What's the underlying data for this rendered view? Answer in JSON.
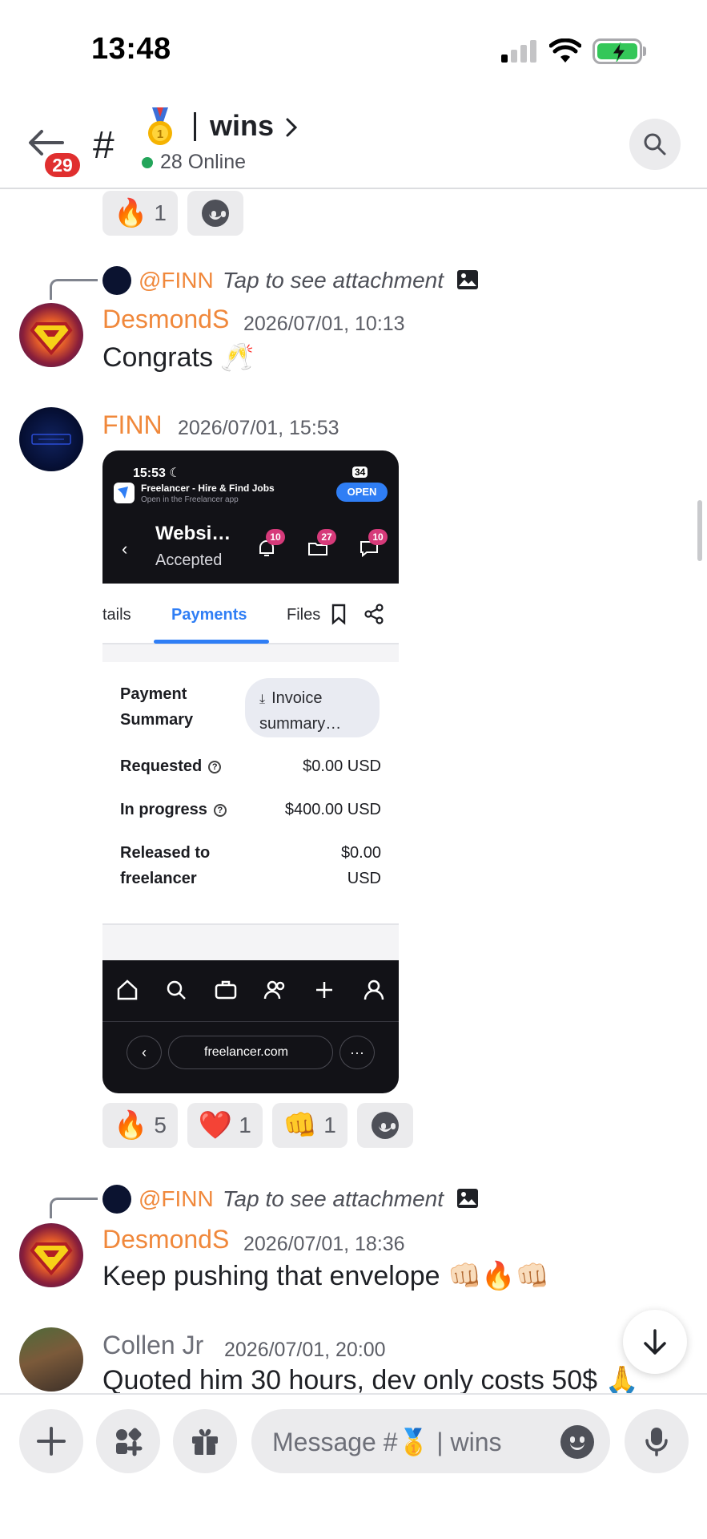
{
  "status_bar": {
    "time": "13:48"
  },
  "header": {
    "back_badge": "29",
    "hash": "#",
    "channel_emoji": "🥇",
    "channel_name": "wins",
    "online_text": "28 Online"
  },
  "messages": [
    {
      "type": "reactions",
      "reactions": [
        {
          "emoji": "🔥",
          "count": "1"
        }
      ]
    },
    {
      "type": "message",
      "reply": {
        "author": "@FINN",
        "text": "Tap to see attachment"
      },
      "author": "DesmondS",
      "timestamp": "2026/07/01, 10:13",
      "text": "Congrats 🥂"
    },
    {
      "type": "message",
      "author": "FINN",
      "timestamp": "2026/07/01, 15:53",
      "attachment": {
        "time": "15:53 ☾",
        "battery": "34",
        "app_name": "Freelancer - Hire & Find Jobs",
        "app_sub": "Open in the Freelancer app",
        "open_label": "OPEN",
        "title": "Websi…",
        "subtitle": "Accepted",
        "badges": [
          "10",
          "27",
          "10"
        ],
        "tabs": [
          "tails",
          "Payments",
          "Files"
        ],
        "payment_summary_label": "Payment Summary",
        "invoice_label": "Invoice summary…",
        "rows": [
          {
            "label": "Requested",
            "value": "$0.00 USD"
          },
          {
            "label": "In progress",
            "value": "$400.00 USD"
          },
          {
            "label": "Released to freelancer",
            "value": "$0.00 USD"
          }
        ],
        "url": "freelancer.com"
      },
      "reactions": [
        {
          "emoji": "🔥",
          "count": "5"
        },
        {
          "emoji": "❤️",
          "count": "1"
        },
        {
          "emoji": "👊",
          "count": "1"
        }
      ]
    },
    {
      "type": "message",
      "reply": {
        "author": "@FINN",
        "text": "Tap to see attachment"
      },
      "author": "DesmondS",
      "timestamp": "2026/07/01, 18:36",
      "text": "Keep pushing that envelope 👊🏻🔥👊🏻"
    },
    {
      "type": "message",
      "author": "Collen Jr",
      "timestamp": "2026/07/01, 20:00",
      "text": "Quoted him 30 hours, dev only costs 50$ 🙏"
    }
  ],
  "composer": {
    "placeholder": "Message #🥇 | wins"
  },
  "colors": {
    "author_orange": "#f0883b",
    "online_green": "#23a55a",
    "badge_red": "#e02f2f",
    "freelancer_blue": "#2f7ef5"
  },
  "icons": [
    "back-arrow-icon",
    "hash-icon",
    "medal-icon",
    "chevron-right-icon",
    "search-icon",
    "image-icon",
    "add-reaction-icon",
    "arrow-down-icon",
    "plus-icon",
    "apps-icon",
    "gift-icon",
    "emoji-icon",
    "microphone-icon"
  ]
}
